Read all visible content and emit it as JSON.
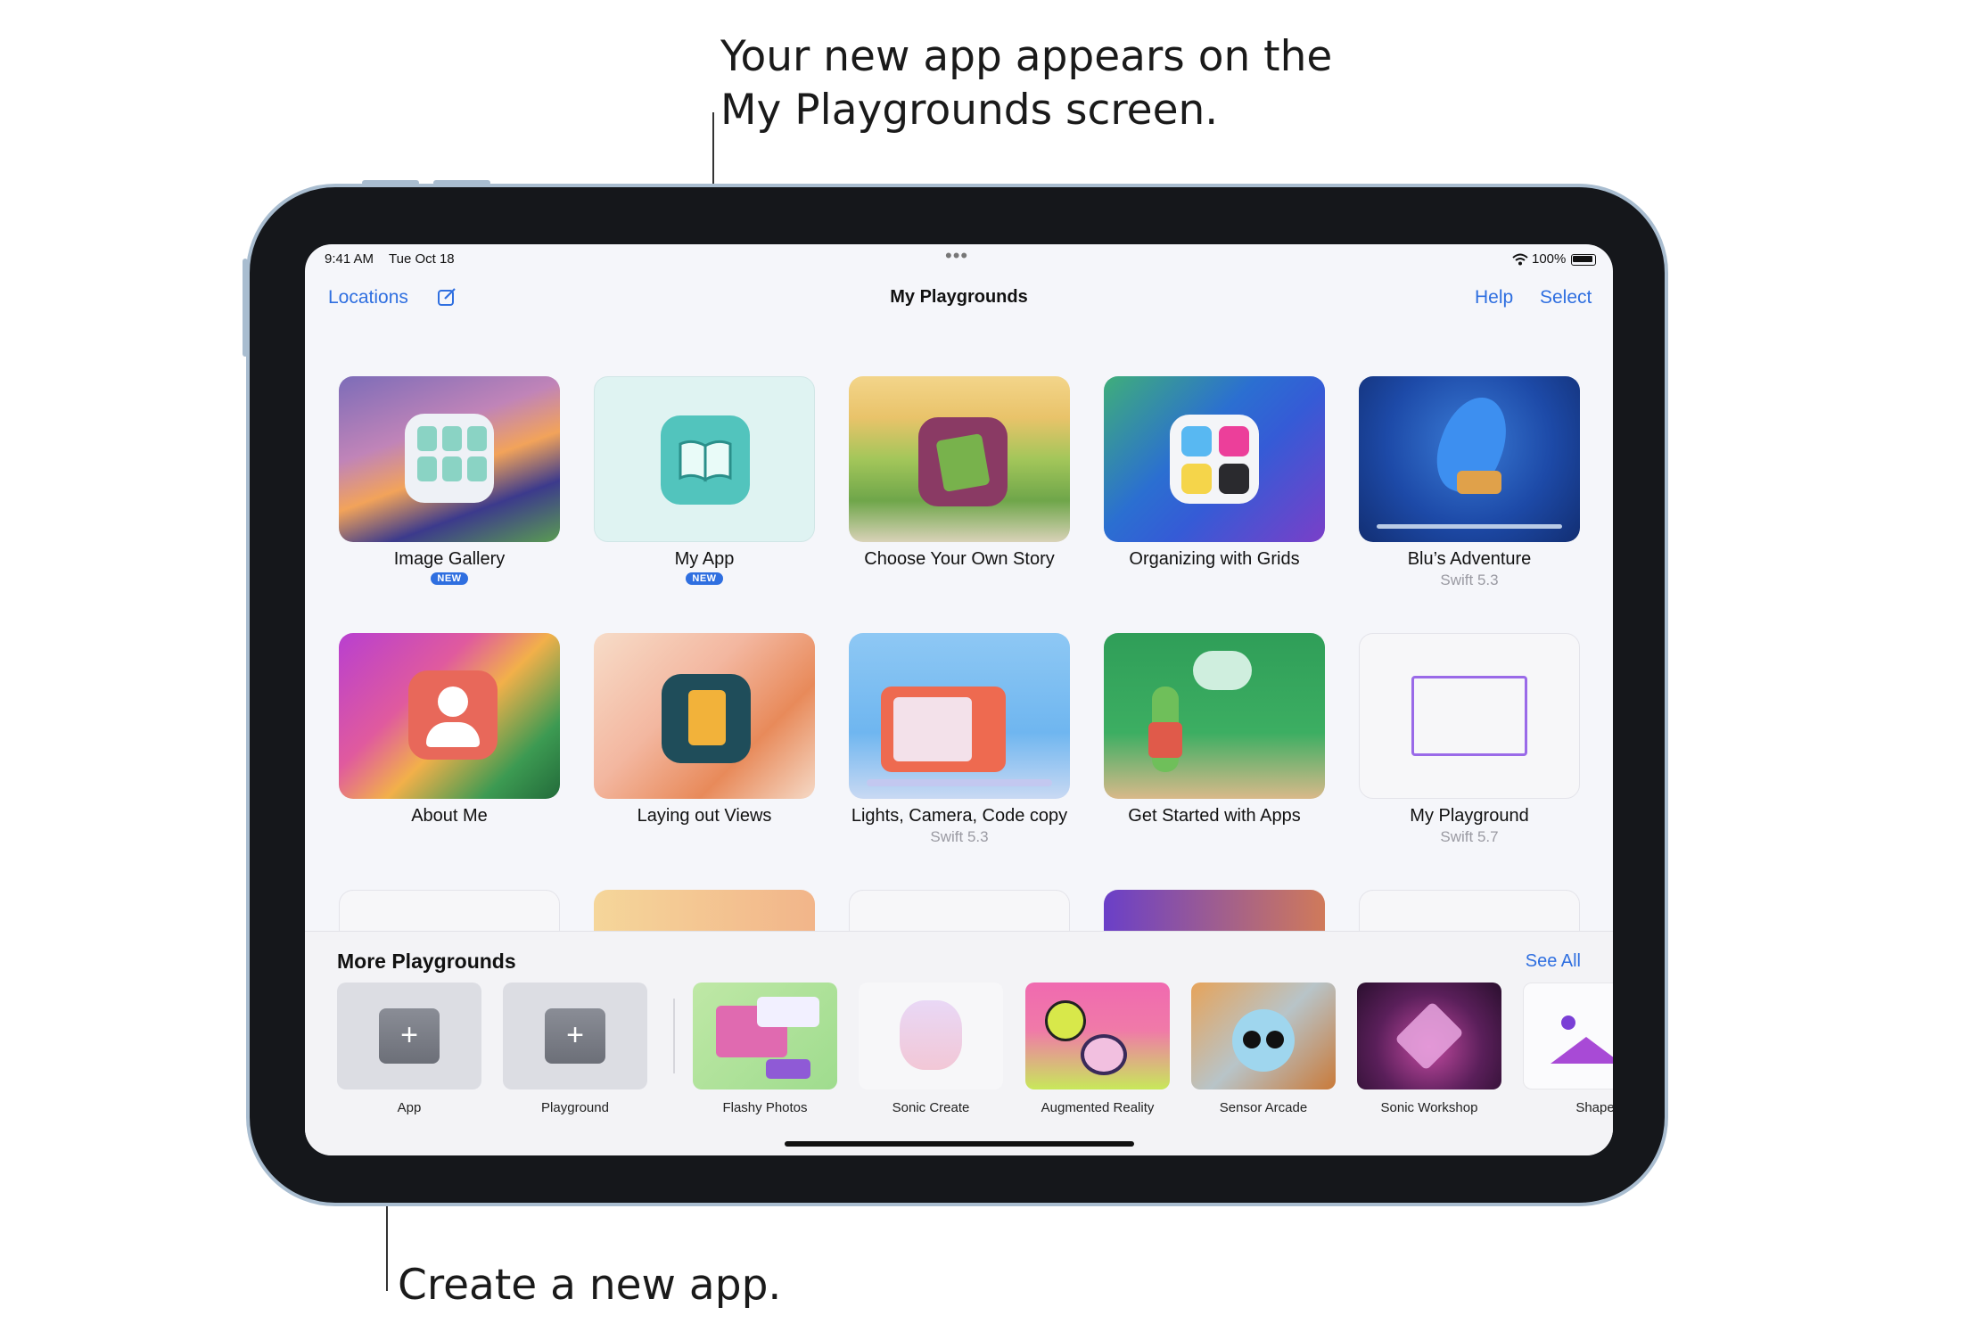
{
  "callouts": {
    "top_line1": "Your new app appears on the",
    "top_line2": "My Playgrounds screen.",
    "bottom": "Create a new app."
  },
  "status_bar": {
    "time": "9:41 AM",
    "date": "Tue Oct 18",
    "battery": "100%"
  },
  "nav": {
    "locations": "Locations",
    "title": "My Playgrounds",
    "help": "Help",
    "select": "Select"
  },
  "tiles": [
    {
      "label": "Image Gallery",
      "badge": "NEW"
    },
    {
      "label": "My App",
      "badge": "NEW"
    },
    {
      "label": "Choose Your Own Story"
    },
    {
      "label": "Organizing with Grids"
    },
    {
      "label": "Blu’s Adventure",
      "sub": "Swift 5.3"
    },
    {
      "label": "About Me"
    },
    {
      "label": "Laying out Views"
    },
    {
      "label": "Lights, Camera, Code copy",
      "sub": "Swift 5.3"
    },
    {
      "label": "Get Started with Apps"
    },
    {
      "label": "My Playground",
      "sub": "Swift 5.7"
    }
  ],
  "more": {
    "title": "More Playgrounds",
    "see_all": "See All",
    "items": [
      {
        "label": "App",
        "icon": "plus-icon"
      },
      {
        "label": "Playground",
        "icon": "plus-icon"
      },
      {
        "label": "Flashy Photos"
      },
      {
        "label": "Sonic Create"
      },
      {
        "label": "Augmented Reality"
      },
      {
        "label": "Sensor Arcade"
      },
      {
        "label": "Sonic Workshop"
      },
      {
        "label": "Shape"
      }
    ]
  },
  "colors": {
    "accent": "#2f6fe0",
    "bezel": "#15171b",
    "frame": "#a9bdd0"
  }
}
